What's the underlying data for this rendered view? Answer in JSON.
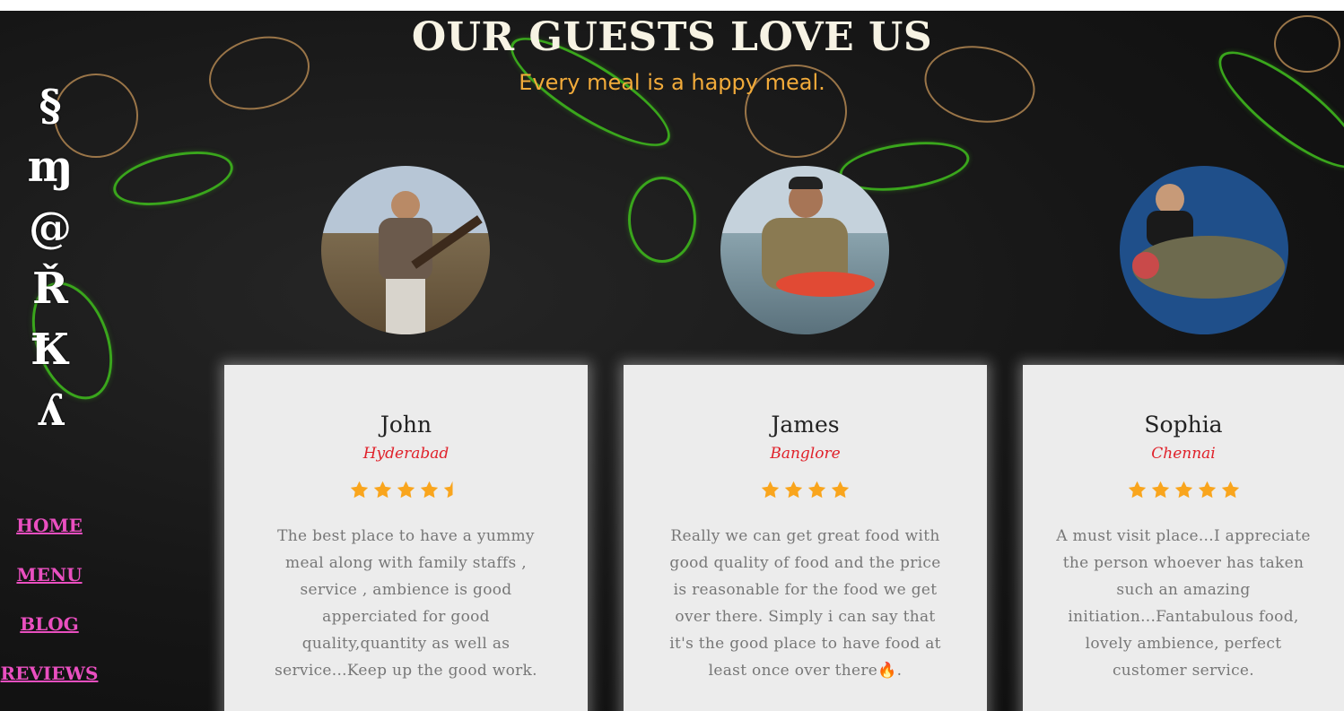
{
  "header": {
    "title": "OUR GUESTS LOVE US",
    "subtitle": "Every meal is a happy meal."
  },
  "logo": {
    "glyphs": [
      "§",
      "ɱ",
      "@",
      "Ř",
      "Ꝁ",
      "ʎ"
    ]
  },
  "nav": {
    "items": [
      {
        "label": "HOME"
      },
      {
        "label": "MENU"
      },
      {
        "label": "BLOG"
      },
      {
        "label": "REVIEWS"
      }
    ]
  },
  "reviews": [
    {
      "name": "John",
      "city": "Hyderabad",
      "rating": 4.5,
      "text": "The best place to have a yummy meal along with family staffs , service , ambience is good apperciated for good quality,quantity as well as service...Keep up the good work."
    },
    {
      "name": "James",
      "city": "Banglore",
      "rating": 4,
      "text": "Really we can get great food with good quality of food and the price is reasonable for the food we get over there. Simply i can say that it's the good place to have food at least once over there🔥."
    },
    {
      "name": "Sophia",
      "city": "Chennai",
      "rating": 5,
      "text": "A must visit place...I appreciate the person whoever has taken such an amazing initiation...Fantabulous food, lovely ambience, perfect customer service."
    }
  ],
  "colors": {
    "background": "#161616",
    "title": "#f7f3e4",
    "subtitle": "#f2ab3a",
    "nav_link": "#ea4fc0",
    "card": "#ececec",
    "city": "#e0212a",
    "star": "#f9a51d",
    "review_text": "#777777"
  },
  "icons": {
    "rating": "star-icon"
  }
}
